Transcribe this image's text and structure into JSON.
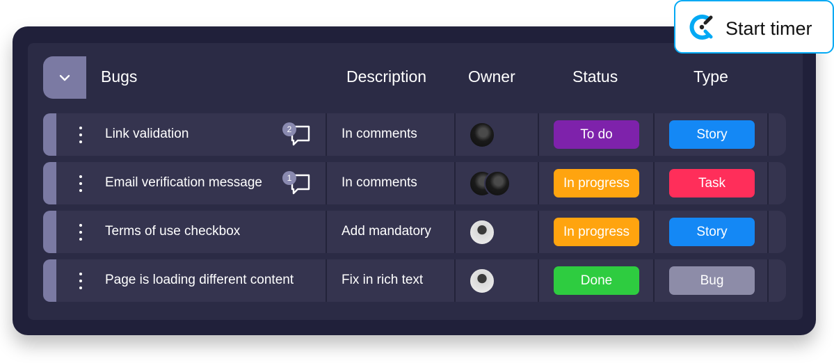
{
  "timer_button": {
    "label": "Start timer",
    "logo": "clockify-logo-icon"
  },
  "table": {
    "group_name": "Bugs",
    "columns": [
      "Description",
      "Owner",
      "Status",
      "Type"
    ],
    "rows": [
      {
        "name": "Link validation",
        "comments": "2",
        "description": "In comments",
        "owners": [
          "dark"
        ],
        "status": {
          "label": "To do",
          "color": "#7e22ab"
        },
        "type": {
          "label": "Story",
          "color": "#1488f5"
        }
      },
      {
        "name": "Email verification message",
        "comments": "1",
        "description": "In comments",
        "owners": [
          "dark",
          "dark"
        ],
        "status": {
          "label": "In progress",
          "color": "#ffa40f"
        },
        "type": {
          "label": "Task",
          "color": "#ff2e5a"
        }
      },
      {
        "name": "Terms of use checkbox",
        "comments": "",
        "description": "Add mandatory",
        "owners": [
          "light"
        ],
        "status": {
          "label": "In progress",
          "color": "#ffa40f"
        },
        "type": {
          "label": "Story",
          "color": "#1488f5"
        }
      },
      {
        "name": "Page is loading different content",
        "comments": "",
        "description": "Fix in rich text",
        "owners": [
          "light"
        ],
        "status": {
          "label": "Done",
          "color": "#2ecc40"
        },
        "type": {
          "label": "Bug",
          "color": "#8d8ca8"
        }
      }
    ]
  },
  "colors": {
    "board_bg": "#20203a",
    "row_bg": "#35344f",
    "accent": "#7b7aa3",
    "timer_border": "#03a9f4"
  }
}
